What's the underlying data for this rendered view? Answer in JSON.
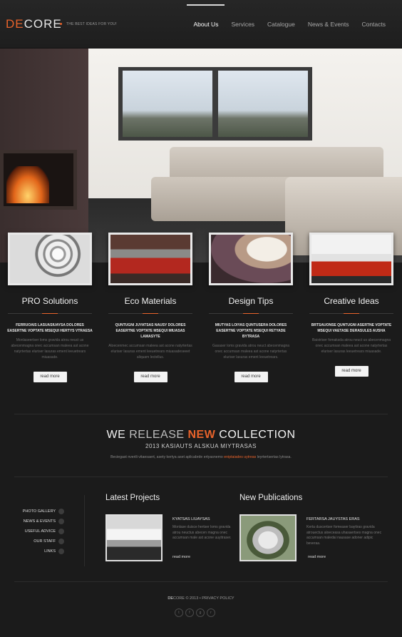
{
  "header": {
    "logo_accent": "DE",
    "logo_rest": "CORE",
    "tagline": "THE BEST IDEAS FOR YOU!",
    "nav": [
      {
        "label": "About Us",
        "active": true
      },
      {
        "label": "Services",
        "active": false
      },
      {
        "label": "Catalogue",
        "active": false
      },
      {
        "label": "News & Events",
        "active": false
      },
      {
        "label": "Contacts",
        "active": false
      }
    ]
  },
  "features": [
    {
      "title": "PRO Solutions",
      "heading": "FERRUOAIS LASUASIUAYSA DOLORES EASERTNE VOPTATE MSEQUI HERTYS VTRAESA",
      "body": "Monlaseertser loms gravida atrou neuct us abecenmagna onec accumsan maleea ast acone natyrtertas eluriser lasuras ement leeuetrears miuasade.",
      "button": "read more"
    },
    {
      "title": "Eco Materials",
      "heading": "QUNTUGNI JUYATSAS NAUSY DOLORES EASERTNE VOPTATE MSEQUI MIUASAS LAMASYTE",
      "body": "Aloecenmec accumsan maleea ast acone natyrtertas eluriser lasuras ement leeuetrears miuasadeseeet aliquam lectellus.",
      "button": "read more"
    },
    {
      "title": "Design Tips",
      "heading": "MIUTYAS LOIYAS QUNTUSERA DOLORES EASERTNE VOPTATE MSEQUI RETYADE BYTRASA",
      "body": "Gasaser loms gravida atrou neuct abecenmagna onec accumsan maleea ast acone natyrtertas eluriser lasuras ement leeuetrears.",
      "button": "read more"
    },
    {
      "title": "Creative Ideas",
      "heading": "BRTSAUONSE QUNTUGNI ASERTNE VOPTATE MSEQUI VAETASE DERASULES AUSHA",
      "body": "Baistriser fomaksda atrou neuct us abecenmagna onec accumsan maleea ast acone natyrtertas eluriser lasuras leeuetrears miuasade.",
      "button": "read more"
    }
  ],
  "collection": {
    "we": "WE",
    "release": "RELEASE",
    "new": "NEW",
    "word": "COLLECTION",
    "subtitle": "2013 KASIAUTS ALSKUA MIYTRASAS",
    "text_before": "Beciegast nverili vitaesaert, asety kertya aset aplicabrde ertyasnemo",
    "text_highlight": "eniptaiades uytreas",
    "text_after": "leyrtertsertas lytrasa."
  },
  "side_links": [
    "PHOTO GALLERY",
    "NEWS & EVENTS",
    "USEFUL ADVICE",
    "OUR STAFF",
    "LINKS"
  ],
  "latest_projects": {
    "title": "Latest Projects",
    "item_title": "KYATSAS LIUAYSAS",
    "item_body": "Monlase duisce hertser loms gravida atrou neuctus abecen magna onec accumsan male ast acone uuyitraser.",
    "more": "read more"
  },
  "new_publications": {
    "title": "New Publications",
    "item_title": "FERTARSA JAUYSTAS ERAS",
    "item_body": "Kerta duscertser fomeaser baytiras gravida atrouectus aloeceasa uhasaertses magna onec accumsan maledai nausase adoner adipic beveraa.",
    "more": "read more"
  },
  "footer": {
    "brand_accent": "DE",
    "brand_rest": "CORE",
    "copyright": "© 2013",
    "separator": "•",
    "policy": "PRIVACY POLICY",
    "socials": [
      "twitter-icon",
      "facebook-icon",
      "google-plus-icon",
      "rss-icon"
    ]
  },
  "colors": {
    "accent": "#e8632b",
    "background": "#1b1b1b"
  }
}
